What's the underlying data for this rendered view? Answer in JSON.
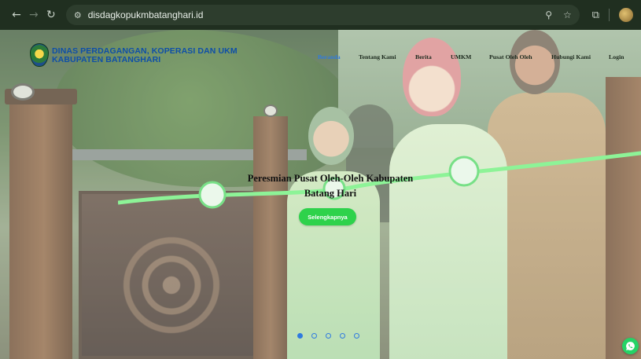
{
  "browser": {
    "url": "disdagkopukmbatanghari.id",
    "icons": [
      "back-icon",
      "forward-icon",
      "reload-icon",
      "site-settings-icon",
      "zoom-icon",
      "bookmark-star-icon",
      "extensions-icon",
      "profile-avatar"
    ]
  },
  "site": {
    "name_line1": "DINAS PERDAGANGAN, KOPERASI DAN UKM",
    "name_line2": "KABUPATEN BATANGHARI",
    "nav": [
      {
        "label": "Beranda",
        "active": true
      },
      {
        "label": "Tentang Kami"
      },
      {
        "label": "Berita"
      },
      {
        "label": "UMKM"
      },
      {
        "label": "Pusat Oleh Oleh"
      },
      {
        "label": "Hubungi Kami"
      },
      {
        "label": "Login"
      }
    ]
  },
  "hero": {
    "caption": "Peresmian Pusat Oleh-Oleh Kabupaten Batang Hari",
    "button_label": "Selengkapnya",
    "slides_total": 5,
    "active_slide": 1
  },
  "colors": {
    "brand_blue": "#0e4fa8",
    "nav_active": "#2f7ae0",
    "cta_green": "#2ed24b",
    "whatsapp_green": "#25d366"
  }
}
